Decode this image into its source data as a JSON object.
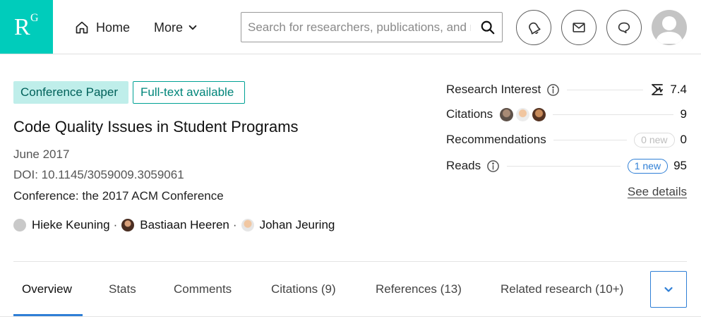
{
  "brand": {
    "logo_r": "R",
    "logo_g": "G",
    "color": "#00ccbb"
  },
  "nav": {
    "home_label": "Home",
    "more_label": "More",
    "search_placeholder": "Search for researchers, publications, and more",
    "icons": [
      "home-icon",
      "chevron-down-icon",
      "search-icon",
      "notifications-icon",
      "mail-icon",
      "chat-icon",
      "user-avatar"
    ]
  },
  "publication": {
    "type_badge": "Conference Paper",
    "fulltext_badge": "Full-text available",
    "title": "Code Quality Issues in Student Programs",
    "date": "June 2017",
    "doi": "DOI: 10.1145/3059009.3059061",
    "conference": "Conference: the 2017 ACM Conference",
    "authors": [
      {
        "name": "Hieke Keuning"
      },
      {
        "name": "Bastiaan Heeren"
      },
      {
        "name": "Johan Jeuring"
      }
    ],
    "author_separator": "·"
  },
  "stats": {
    "research_interest": {
      "label": "Research Interest",
      "value": "7.4"
    },
    "citations": {
      "label": "Citations",
      "value": "9"
    },
    "recommendations": {
      "label": "Recommendations",
      "badge": "0 new",
      "value": "0"
    },
    "reads": {
      "label": "Reads",
      "badge": "1 new",
      "value": "95"
    },
    "see_details": "See details"
  },
  "tabs": [
    {
      "label": "Overview",
      "active": true
    },
    {
      "label": "Stats"
    },
    {
      "label": "Comments"
    },
    {
      "label": "Citations (9)"
    },
    {
      "label": "References (13)"
    },
    {
      "label": "Related research (10+)"
    }
  ],
  "colors": {
    "accent_blue": "#2f7fd6",
    "teal_badge_bg": "#bfeeea",
    "teal_text": "#00857a"
  }
}
